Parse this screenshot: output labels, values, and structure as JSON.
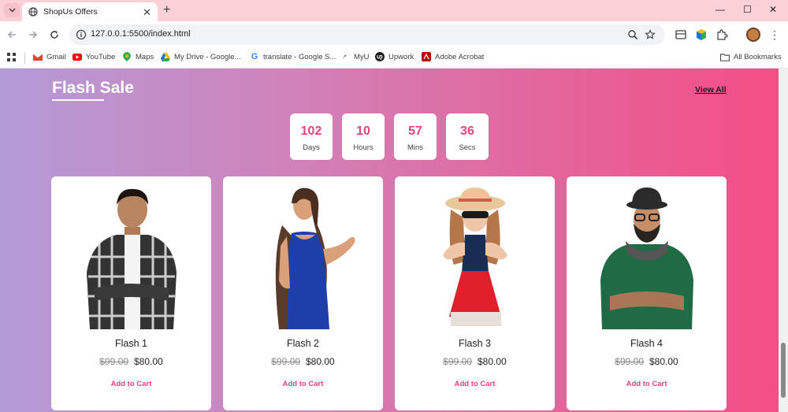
{
  "browser": {
    "tab_title": "ShopUs Offers",
    "url": "127.0.0.1:5500/index.html",
    "bookmarks": [
      "Gmail",
      "YouTube",
      "Maps",
      "My Drive - Google...",
      "translate - Google S...",
      "MyU",
      "Upwork",
      "Adobe Acrobat"
    ],
    "all_bookmarks": "All Bookmarks"
  },
  "section": {
    "title": "Flash Sale",
    "view_all": "View All"
  },
  "countdown": [
    {
      "value": "102",
      "label": "Days"
    },
    {
      "value": "10",
      "label": "Hours"
    },
    {
      "value": "57",
      "label": "Mins"
    },
    {
      "value": "36",
      "label": "Secs"
    }
  ],
  "products": [
    {
      "name": "Flash 1",
      "old_price": "$99.00",
      "price": "$80.00",
      "cta": "Add to Cart"
    },
    {
      "name": "Flash 2",
      "old_price": "$99.00",
      "price": "$80.00",
      "cta": "Add to Cart"
    },
    {
      "name": "Flash 3",
      "old_price": "$99.00",
      "price": "$80.00",
      "cta": "Add to Cart"
    },
    {
      "name": "Flash 4",
      "old_price": "$99.00",
      "price": "$80.00",
      "cta": "Add to Cart"
    }
  ],
  "colors": {
    "accent": "#e0457b",
    "gradient_start": "#b39bd7",
    "gradient_end": "#f44e85"
  }
}
